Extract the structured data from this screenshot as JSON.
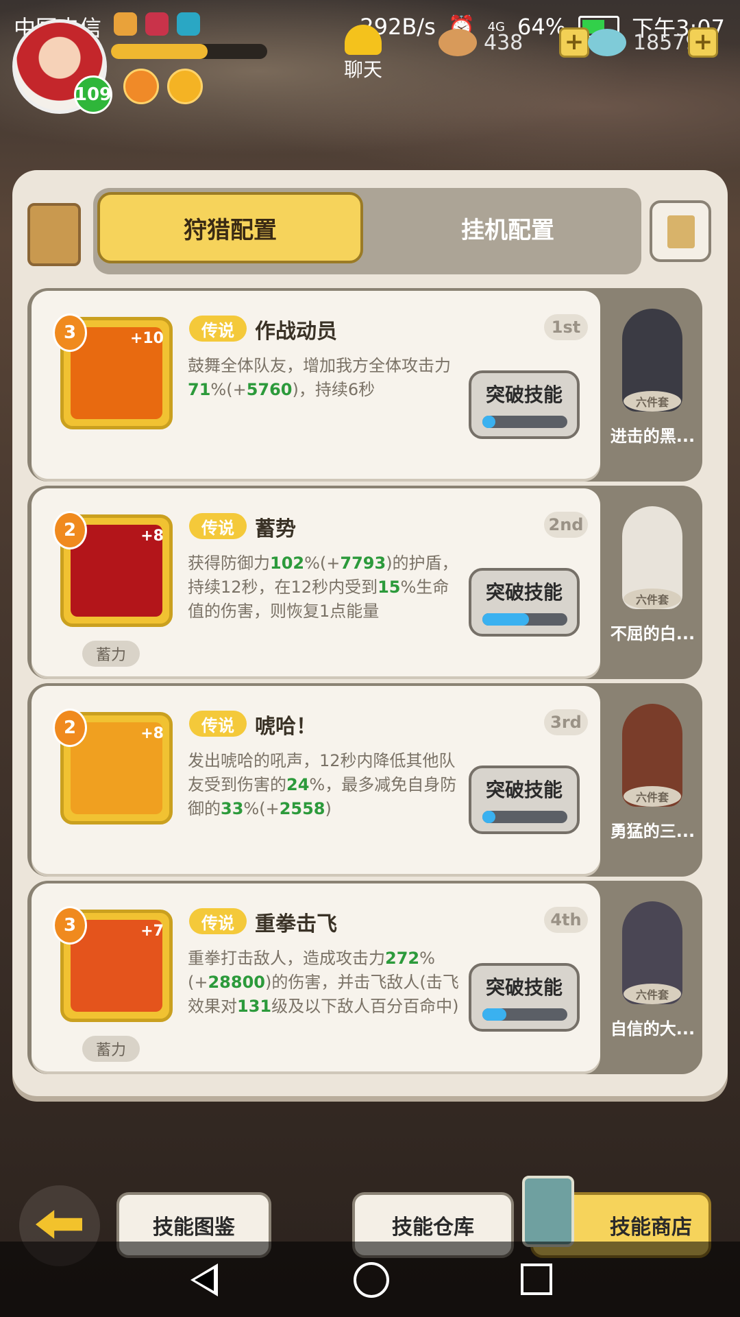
{
  "status_bar": {
    "carrier": "中国电信",
    "net_speed": "292B/s",
    "network": "4G",
    "battery": "64%",
    "time": "下午3:07"
  },
  "player": {
    "level": "109",
    "xp_fraction": 0.62
  },
  "chat": {
    "label": "聊天"
  },
  "currencies": [
    {
      "icon": "coins-icon",
      "amount": "438"
    },
    {
      "icon": "gem-icon",
      "amount": "18579"
    }
  ],
  "tabs": [
    {
      "label": "狩猎配置",
      "active": true
    },
    {
      "label": "挂机配置",
      "active": false
    }
  ],
  "skills": [
    {
      "rarity": "传说",
      "name": "作战动员",
      "rank": "1st",
      "level": "3",
      "bonus": "+10",
      "charge": "",
      "desc": [
        {
          "t": "鼓舞全体队友，增加我方全体攻击力"
        },
        {
          "t": "71",
          "g": 1
        },
        {
          "t": "%(+"
        },
        {
          "t": "5760",
          "g": 1
        },
        {
          "t": ")，持续6秒"
        }
      ],
      "breakthrough_label": "突破技能",
      "progress": 0.15,
      "pet": {
        "name": "进击的黑...",
        "set": "六件套",
        "color": "#3b3b44"
      },
      "icon_color": "#e86a10"
    },
    {
      "rarity": "传说",
      "name": "蓄势",
      "rank": "2nd",
      "level": "2",
      "bonus": "+8",
      "charge": "蓄力",
      "desc": [
        {
          "t": "获得防御力"
        },
        {
          "t": "102",
          "g": 1
        },
        {
          "t": "%(+"
        },
        {
          "t": "7793",
          "g": 1
        },
        {
          "t": ")的护盾，持续12秒，在12秒内受到"
        },
        {
          "t": "15",
          "g": 1
        },
        {
          "t": "%生命值的伤害，则恢复1点能量"
        }
      ],
      "breakthrough_label": "突破技能",
      "progress": 0.55,
      "pet": {
        "name": "不屈的白...",
        "set": "六件套",
        "color": "#e8e3da"
      },
      "icon_color": "#b3151a"
    },
    {
      "rarity": "传说",
      "name": "唬哈！",
      "rank": "3rd",
      "level": "2",
      "bonus": "+8",
      "charge": "",
      "desc": [
        {
          "t": "发出唬哈的吼声，12秒内降低其他队友受到伤害的"
        },
        {
          "t": "24",
          "g": 1
        },
        {
          "t": "%，最多减免自身防御的"
        },
        {
          "t": "33",
          "g": 1
        },
        {
          "t": "%(+"
        },
        {
          "t": "2558",
          "g": 1
        },
        {
          "t": ")"
        }
      ],
      "breakthrough_label": "突破技能",
      "progress": 0.15,
      "pet": {
        "name": "勇猛的三...",
        "set": "六件套",
        "color": "#7a3d2a"
      },
      "icon_color": "#f0a020"
    },
    {
      "rarity": "传说",
      "name": "重拳击飞",
      "rank": "4th",
      "level": "3",
      "bonus": "+7",
      "charge": "蓄力",
      "desc": [
        {
          "t": "重拳打击敌人，造成攻击力"
        },
        {
          "t": "272",
          "g": 1
        },
        {
          "t": "%(+"
        },
        {
          "t": "28800",
          "g": 1
        },
        {
          "t": ")的伤害，并击飞敌人(击飞效果对"
        },
        {
          "t": "131",
          "g": 1
        },
        {
          "t": "级及以下敌人百分百命中)"
        }
      ],
      "breakthrough_label": "突破技能",
      "progress": 0.28,
      "pet": {
        "name": "自信的大...",
        "set": "六件套",
        "color": "#4a4654"
      },
      "icon_color": "#e4541c"
    }
  ],
  "bottom": {
    "codex": "技能图鉴",
    "storage": "技能仓库",
    "shop": "技能商店"
  }
}
